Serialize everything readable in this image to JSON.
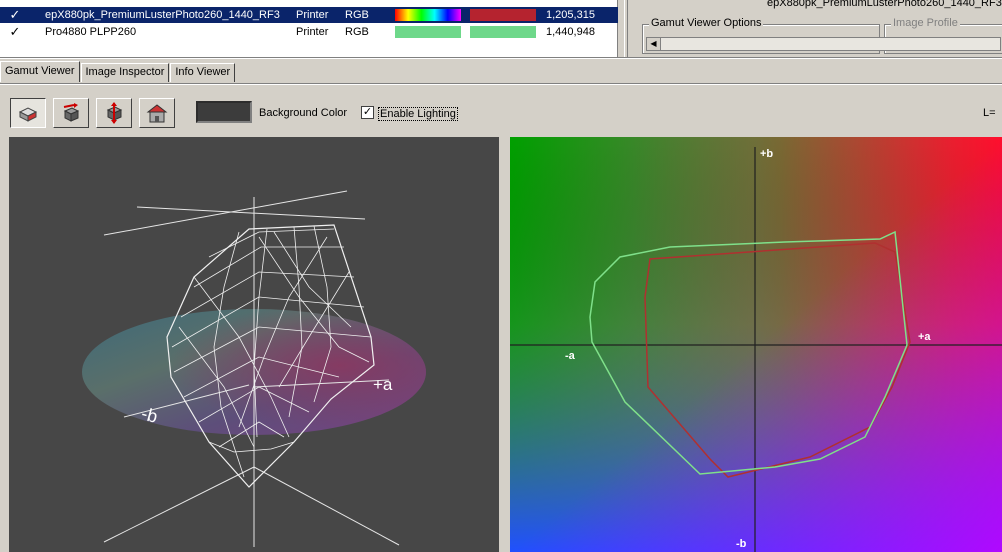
{
  "profiles": [
    {
      "checked": "✓",
      "name": "epX880pk_PremiumLusterPhoto260_1440_RF3",
      "type": "Printer",
      "space": "RGB",
      "count": "1,205,315",
      "selected": true
    },
    {
      "checked": "✓",
      "name": "Pro4880 PLPP260",
      "type": "Printer",
      "space": "RGB",
      "count": "1,440,948",
      "selected": false
    }
  ],
  "right_panel": {
    "title": "epX880pk_PremiumLusterPhoto260_1440_RF3",
    "gamut_options_label": "Gamut Viewer Options",
    "image_profile_label": "Image Profile"
  },
  "tabs": [
    {
      "label": "Gamut Viewer",
      "active": true
    },
    {
      "label": "Image Inspector",
      "active": false
    },
    {
      "label": "Info Viewer",
      "active": false
    }
  ],
  "toolbar": {
    "buttons": [
      "view-3d-icon",
      "rotate-icon",
      "flip-icon",
      "home-icon"
    ],
    "background_color_label": "Background Color",
    "background_color": "#3c3c3c",
    "enable_lighting_label": "Enable Lighting",
    "enable_lighting_checked": "✓",
    "l_field_label": "L="
  },
  "view3d": {
    "axis_plus_a": "+a",
    "axis_minus_b": "-b"
  },
  "view2d": {
    "axis_plus_b": "+b",
    "axis_minus_b": "-b",
    "axis_plus_a": "+a",
    "axis_minus_a": "-a",
    "gamut_colors": {
      "outer": "#7fe08a",
      "inner": "#b03030"
    }
  },
  "colors": {
    "selection": "#0a246a",
    "swatch_red": "#b5232f",
    "swatch_green": "#6ed88a"
  }
}
